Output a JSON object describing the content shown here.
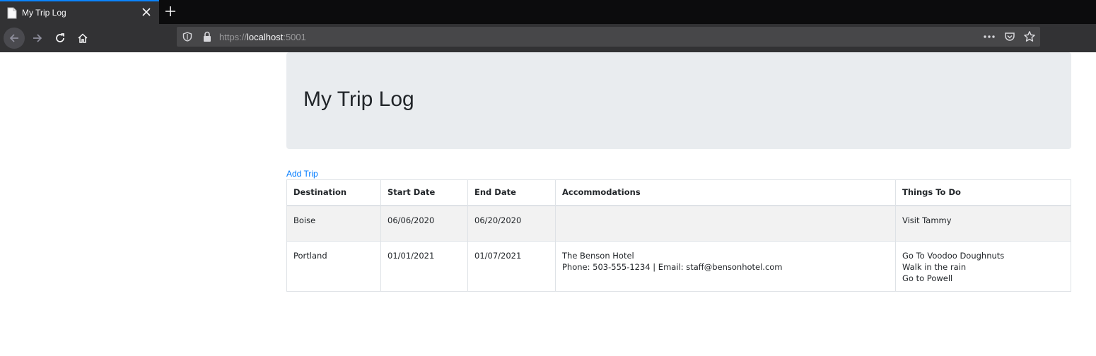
{
  "browser": {
    "tab_title": "My Trip Log",
    "url_scheme": "https://",
    "url_host": "localhost",
    "url_port": ":5001"
  },
  "page": {
    "title": "My Trip Log",
    "add_trip_label": "Add Trip"
  },
  "table": {
    "headers": [
      "Destination",
      "Start Date",
      "End Date",
      "Accommodations",
      "Things To Do"
    ],
    "rows": [
      {
        "destination": "Boise",
        "start_date": "06/06/2020",
        "end_date": "06/20/2020",
        "accommodations": [
          "",
          ""
        ],
        "things_to_do": [
          "Visit Tammy",
          "",
          ""
        ]
      },
      {
        "destination": "Portland",
        "start_date": "01/01/2021",
        "end_date": "01/07/2021",
        "accommodations": [
          "The Benson Hotel",
          "Phone: 503-555-1234 | Email: staff@bensonhotel.com"
        ],
        "things_to_do": [
          "Go To Voodoo Doughnuts",
          "Walk in the rain",
          "Go to Powell"
        ]
      }
    ]
  },
  "colors": {
    "jumbotron_bg": "#e9ecef",
    "link": "#007bff",
    "tab_accent": "#0a84ff"
  }
}
